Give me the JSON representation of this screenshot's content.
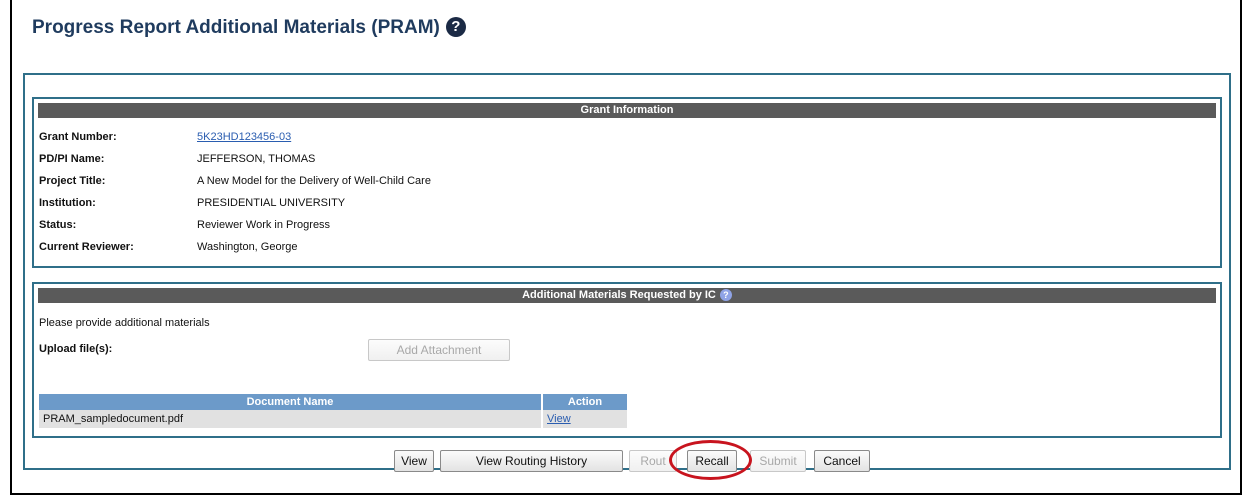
{
  "page": {
    "title": "Progress Report Additional Materials (PRAM)",
    "help_glyph": "?",
    "help_icon": "question-circle-icon"
  },
  "grant_info": {
    "header": "Grant Information",
    "rows": [
      {
        "label": "Grant Number:",
        "value": "5K23HD123456-03",
        "link": true
      },
      {
        "label": "PD/PI Name:",
        "value": "JEFFERSON, THOMAS"
      },
      {
        "label": "Project Title:",
        "value": "A New Model for the Delivery of Well-Child Care"
      },
      {
        "label": "Institution:",
        "value": "PRESIDENTIAL UNIVERSITY"
      },
      {
        "label": "Status:",
        "value": "Reviewer Work in Progress"
      },
      {
        "label": "Current Reviewer:",
        "value": "Washington, George"
      }
    ]
  },
  "materials": {
    "header": "Additional Materials Requested by IC",
    "help_glyph": "?",
    "instructions": "Please provide additional materials",
    "upload_label": "Upload file(s):",
    "add_attachment_label": "Add Attachment",
    "table": {
      "columns": [
        "Document Name",
        "Action"
      ],
      "rows": [
        {
          "name": "PRAM_sampledocument.pdf",
          "action": "View"
        }
      ]
    }
  },
  "actions": {
    "view": "View",
    "view_routing_history": "View Routing History",
    "route": "Rout",
    "recall": "Recall",
    "submit": "Submit",
    "cancel": "Cancel"
  },
  "colors": {
    "title": "#1f3b5e",
    "panel_border": "#2f6f89",
    "section_header": "#5a5a5a",
    "table_header": "#6c9ac9",
    "highlight": "#c8141e",
    "link": "#2a5db0"
  }
}
